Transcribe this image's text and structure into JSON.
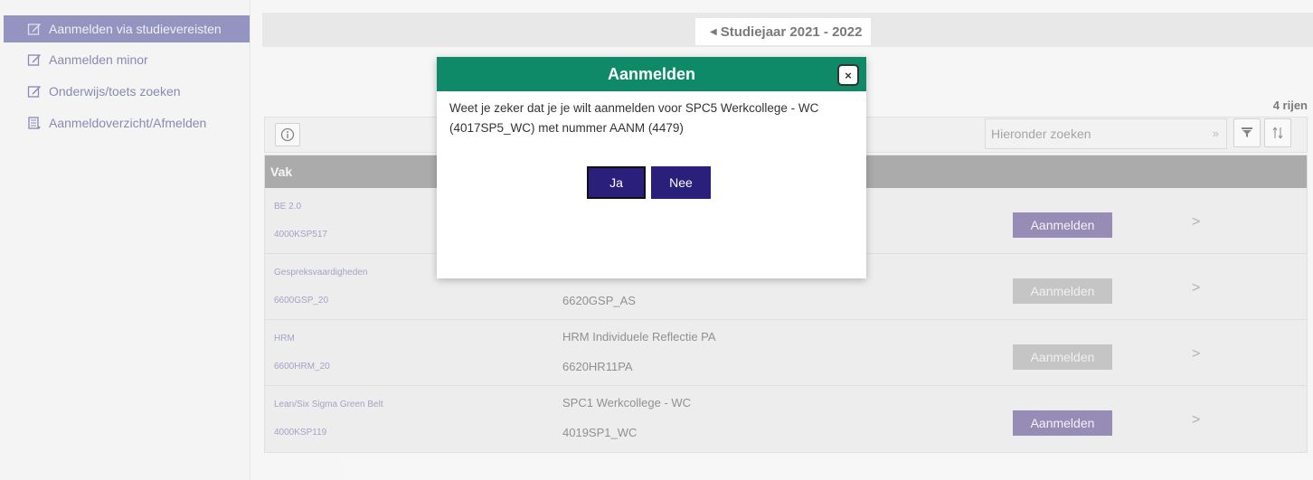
{
  "sidebar": {
    "items": [
      {
        "label": "Aanmelden via studievereisten",
        "icon": "edit-icon",
        "active": true
      },
      {
        "label": "Aanmelden minor",
        "icon": "edit-icon"
      },
      {
        "label": "Onderwijs/toets zoeken",
        "icon": "edit-icon"
      },
      {
        "label": "Aanmeldoverzicht/Afmelden",
        "icon": "list-icon"
      }
    ]
  },
  "header": {
    "year": "Studiejaar 2021 - 2022",
    "rows_count": "4 rijen"
  },
  "search": {
    "placeholder": "Hieronder zoeken",
    "go": "»"
  },
  "table": {
    "column_vak": "Vak",
    "rows": [
      {
        "course": "BE 2.0",
        "code": "4000KSP517",
        "desc": "",
        "desc_code": "",
        "button": "Aanmelden",
        "enabled": true
      },
      {
        "course": "Gespreksvaardigheden",
        "code": "6600GSP_20",
        "desc": "",
        "desc_code": "6620GSP_AS",
        "button": "Aanmelden",
        "enabled": false
      },
      {
        "course": "HRM",
        "code": "6600HRM_20",
        "desc": "HRM Individuele Reflectie PA",
        "desc_code": "6620HR11PA",
        "button": "Aanmelden",
        "enabled": false
      },
      {
        "course": "Lean/Six Sigma Green Belt",
        "code": "4000KSP119",
        "desc": "SPC1 Werkcollege - WC",
        "desc_code": "4019SP1_WC",
        "button": "Aanmelden",
        "enabled": true
      }
    ]
  },
  "modal": {
    "title": "Aanmelden",
    "close": "×",
    "message": "Weet je zeker dat je je wilt aanmelden voor SPC5 Werkcollege - WC (4017SP5_WC) met nummer AANM (4479)",
    "yes": "Ja",
    "no": "Nee"
  },
  "colors": {
    "modal_header": "#0e8a68",
    "primary_button": "#2a1f7a",
    "enabled_register": "#5e4f8e",
    "disabled_register": "#a7a7a7",
    "sidebar_active": "#5b5b9e"
  }
}
